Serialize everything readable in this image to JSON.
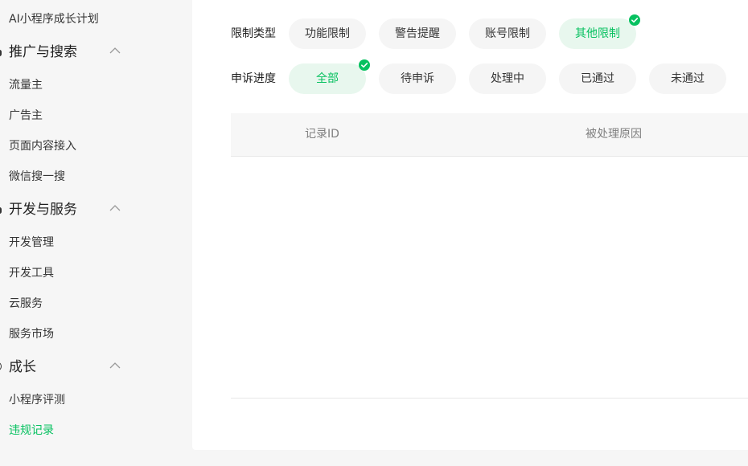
{
  "sidebar": {
    "top_item": "AI小程序成长计划",
    "groups": [
      {
        "label": "推广与搜索",
        "icon": "chevron-up-icon",
        "items": [
          "流量主",
          "广告主",
          "页面内容接入",
          "微信搜一搜"
        ]
      },
      {
        "label": "开发与服务",
        "icon": "chevron-up-icon",
        "items": [
          "开发管理",
          "开发工具",
          "云服务",
          "服务市场"
        ]
      },
      {
        "label": "成长",
        "icon": "chevron-up-icon",
        "items": [
          "小程序评测",
          "违规记录"
        ]
      }
    ],
    "active_item": "违规记录"
  },
  "filters": {
    "restriction_type": {
      "label": "限制类型",
      "options": [
        "功能限制",
        "警告提醒",
        "账号限制",
        "其他限制"
      ],
      "selected": "其他限制"
    },
    "appeal_progress": {
      "label": "申诉进度",
      "options": [
        "全部",
        "待申诉",
        "处理中",
        "已通过",
        "未通过"
      ],
      "selected": "全部"
    }
  },
  "table": {
    "columns": [
      "记录ID",
      "被处理原因"
    ],
    "rows": []
  },
  "colors": {
    "accent": "#07c160",
    "selected_bg": "#e8f7ee",
    "pill_bg": "#f5f5f5",
    "page_bg": "#f6f6f6"
  }
}
